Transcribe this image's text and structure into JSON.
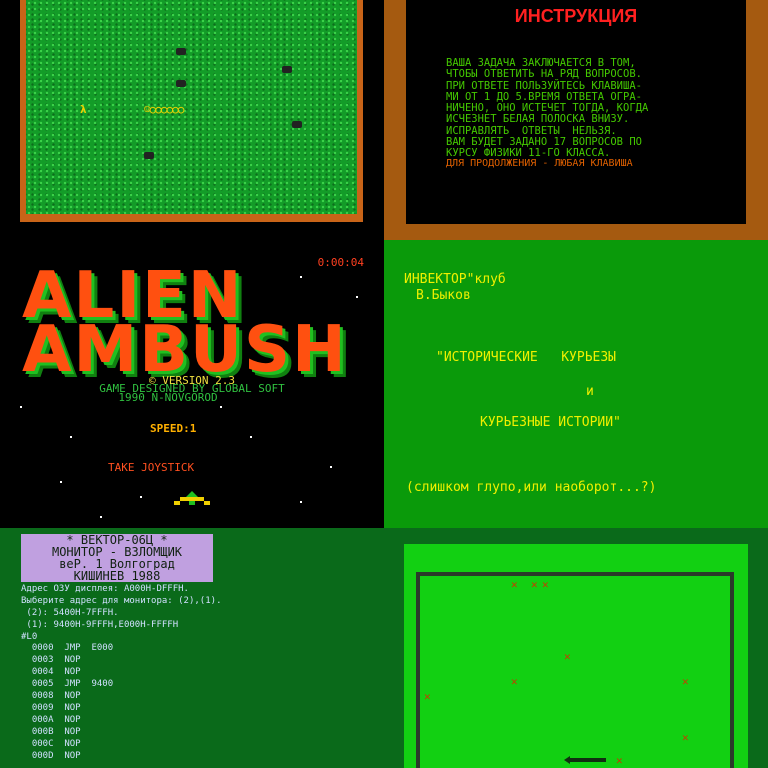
{
  "snake_game": {
    "snake": "☺○○○○○○",
    "food": "λ"
  },
  "instructions": {
    "title": "ИНСТРУКЦИЯ",
    "lines": [
      "ВАША ЗАДАЧА ЗАКЛЮЧАЕТСЯ В ТОМ,",
      "ЧТОБЫ ОТВЕТИТЬ НА РЯД ВОПРОСОВ.",
      "ПРИ ОТВЕТЕ ПОЛЬЗУЙТЕСЬ КЛАВИША-",
      "МИ ОТ 1 ДО 5.ВРЕМЯ ОТВЕТА ОГРА-",
      "НИЧЕНО, ОНО ИСТЕЧЕТ ТОГДА, КОГДА",
      "ИСЧЕЗНЕТ БЕЛАЯ ПОЛОСКА ВНИЗУ.",
      "ИСПРАВЛЯТЬ  ОТВЕТЫ  НЕЛЬЗЯ.",
      "ВАМ БУДЕТ ЗАДАНО 17 ВОПРОСОВ ПО",
      "КУРСУ ФИЗИКИ 11-ГО КЛАССА."
    ],
    "continue": "ДЛЯ ПРОДОЛЖЕНИЯ - ЛЮБАЯ КЛАВИША"
  },
  "alien_ambush": {
    "timer": "0:00:04",
    "logo_line1": "ALIEN",
    "logo_line2": "AMBUSH",
    "version": "© VERSION 2.3",
    "designed": "GAME DESIGNED BY GLOBAL SOFT",
    "city": "1990 N-NOVGOROD",
    "speed": "SPEED:1",
    "take": "TAKE  JOYSTICK"
  },
  "title_screen": {
    "club": "ИНВЕКТОР\"клуб",
    "author": "В.Быков",
    "line1": "\"ИСТОРИЧЕСКИЕ   КУРЬЕЗЫ",
    "and": "и",
    "line2": "КУРЬЕЗНЫЕ ИСТОРИИ\"",
    "subtitle": "(слишком глупо,или наоборот...?)"
  },
  "monitor": {
    "header": [
      "*  ВЕКТОР-06Ц  *",
      "МОНИТОР - ВЗЛОМЩИК",
      "веР. 1  Волгоград",
      "КИШИНЕВ 1988"
    ],
    "info": [
      "Адрес ОЗУ дисплея: A000H-DFFFH.",
      "Выберите адрес для монитора: (2),(1).",
      " (2): 5400H-7FFFH.",
      " (1): 9400H-9FFFH,E000H-FFFFH",
      "#L0"
    ],
    "listing": [
      "  0000  JMP  E000",
      "  0003  NOP",
      "  0004  NOP",
      "  0005  JMP  9400",
      "  0008  NOP",
      "  0009  NOP",
      "  000A  NOP",
      "  000B  NOP",
      "  000C  NOP",
      "  000D  NOP"
    ]
  }
}
